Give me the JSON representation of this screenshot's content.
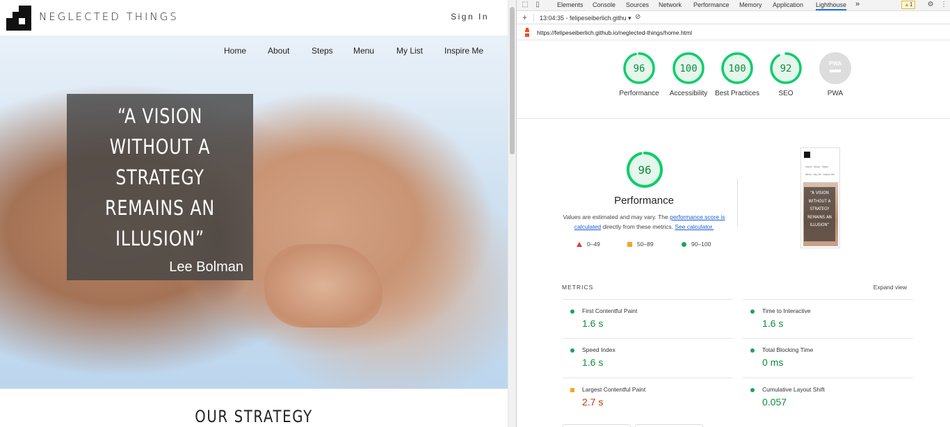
{
  "site": {
    "brand": "NEGLECTED THINGS",
    "sign_in": "Sign In",
    "nav": [
      "Home",
      "About",
      "Steps",
      "Menu",
      "My List",
      "Inspire Me"
    ],
    "quote": "“A VISION WITHOUT A STRATEGY REMAINS AN ILLUSION”",
    "quote_lines": [
      "“A VISION",
      "WITHOUT A",
      "STRATEGY",
      "REMAINS AN",
      "ILLUSION”"
    ],
    "author": "Lee Bolman",
    "section_title": "OUR STRATEGY"
  },
  "devtools": {
    "tabs": [
      "Elements",
      "Console",
      "Sources",
      "Network",
      "Performance",
      "Memory",
      "Application",
      "Lighthouse"
    ],
    "active_tab": "Lighthouse",
    "more_tabs": "»",
    "warnings": "1",
    "report_label": "13:04:35 - felipeseiberlich.githu",
    "url": "https://felipeseiberlich.github.io/neglected-things/home.html",
    "categories": [
      {
        "name": "Performance",
        "score": 96
      },
      {
        "name": "Accessibility",
        "score": 100
      },
      {
        "name": "Best Practices",
        "score": 100
      },
      {
        "name": "SEO",
        "score": 92
      },
      {
        "name": "PWA",
        "score": null,
        "badge": "PWA"
      }
    ],
    "performance": {
      "score": "96",
      "title": "Performance",
      "desc_prefix": "Values are estimated and may vary. The ",
      "desc_link1": "performance score is calculated",
      "desc_mid": " directly from these metrics. ",
      "desc_link2": "See calculator.",
      "legend": [
        "0–49",
        "50–89",
        "90–100"
      ]
    },
    "preview": {
      "quote_lines": [
        "“A VISION",
        "WITHOUT A",
        "STRATEGY",
        "REMAINS AN",
        "ILLUSION”"
      ]
    },
    "metrics_title": "METRICS",
    "expand_view": "Expand view",
    "metrics": [
      {
        "name": "First Contentful Paint",
        "value": "1.6 s",
        "status": "good"
      },
      {
        "name": "Time to Interactive",
        "value": "1.6 s",
        "status": "good"
      },
      {
        "name": "Speed Index",
        "value": "1.6 s",
        "status": "good"
      },
      {
        "name": "Total Blocking Time",
        "value": "0 ms",
        "status": "good"
      },
      {
        "name": "Largest Contentful Paint",
        "value": "2.7 s",
        "status": "average"
      },
      {
        "name": "Cumulative Layout Shift",
        "value": "0.057",
        "status": "good"
      }
    ],
    "colors": {
      "good": "#0c8e3a",
      "average": "#c33300",
      "accent": "#1a73e8"
    }
  }
}
